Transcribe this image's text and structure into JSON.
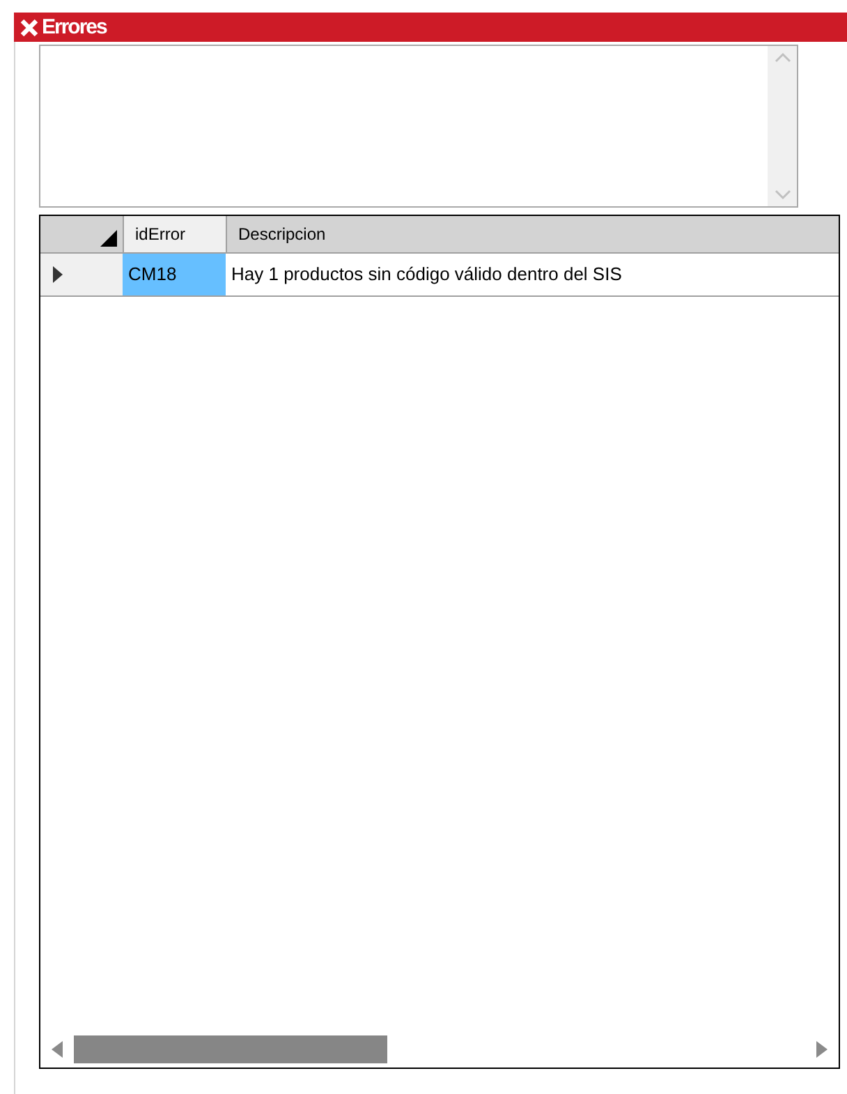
{
  "panel": {
    "title": "Errores"
  },
  "grid": {
    "columns": [
      "idError",
      "Descripcion"
    ],
    "rows": [
      {
        "current": true,
        "cells": [
          {
            "text": "CM18",
            "selected": true
          },
          {
            "text": "Hay 1 productos sin código válido dentro del SIS",
            "selected": false
          }
        ]
      }
    ]
  }
}
